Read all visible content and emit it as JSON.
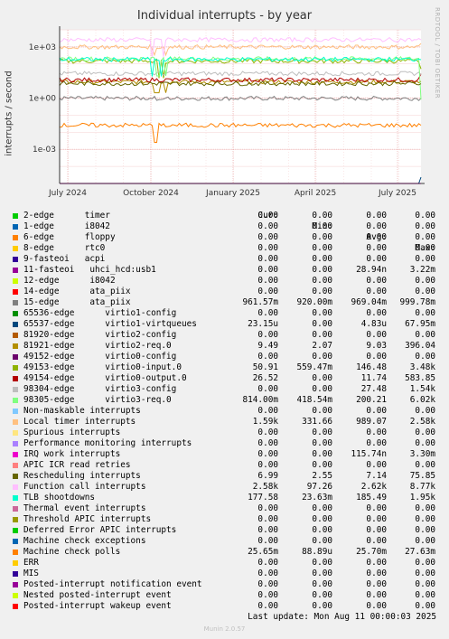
{
  "title": "Individual interrupts - by year",
  "side_label": "RRDTOOL / TOBI OETIKER",
  "footer": "Munin 2.0.57",
  "last_update": "Last update: Mon Aug 11 00:00:03 2025",
  "column_headers": {
    "cur": "Cur:",
    "min": "Min:",
    "avg": "Avg:",
    "max": "Max:"
  },
  "chart_data": {
    "type": "line",
    "title": "Individual interrupts - by year",
    "ylabel": "interrupts / second",
    "yscale": "log",
    "ylim": [
      1e-05,
      10000
    ],
    "y_ticks": [
      "1e+03",
      "1e+00",
      "1e-03"
    ],
    "x_ticks": [
      "July 2024",
      "October 2024",
      "January 2025",
      "April 2025",
      "July 2025"
    ],
    "grid": true,
    "series": [
      {
        "name": "2-edge      timer",
        "color": "#00cc00",
        "cur": "0.00",
        "min": "0.00",
        "avg": "0.00",
        "max": "0.00"
      },
      {
        "name": "1-edge      i8042",
        "color": "#0066b3",
        "cur": "0.00",
        "min": "0.00",
        "avg": "0.00",
        "max": "0.00"
      },
      {
        "name": "6-edge      floppy",
        "color": "#ff8000",
        "cur": "0.00",
        "min": "0.00",
        "avg": "0.00",
        "max": "0.00"
      },
      {
        "name": "8-edge      rtc0",
        "color": "#ffcc00",
        "cur": "0.00",
        "min": "0.00",
        "avg": "0.00",
        "max": "0.00"
      },
      {
        "name": "9-fasteoi   acpi",
        "color": "#330099",
        "cur": "0.00",
        "min": "0.00",
        "avg": "0.00",
        "max": "0.00"
      },
      {
        "name": "11-fasteoi   uhci_hcd:usb1",
        "color": "#990099",
        "cur": "0.00",
        "min": "0.00",
        "avg": "28.94n",
        "max": "3.22m"
      },
      {
        "name": "12-edge      i8042",
        "color": "#ccff00",
        "cur": "0.00",
        "min": "0.00",
        "avg": "0.00",
        "max": "0.00"
      },
      {
        "name": "14-edge      ata_piix",
        "color": "#ff0000",
        "cur": "0.00",
        "min": "0.00",
        "avg": "0.00",
        "max": "0.00"
      },
      {
        "name": "15-edge      ata_piix",
        "color": "#808080",
        "cur": "961.57m",
        "min": "920.00m",
        "avg": "969.04m",
        "max": "999.78m"
      },
      {
        "name": "65536-edge      virtio1-config",
        "color": "#008f00",
        "cur": "0.00",
        "min": "0.00",
        "avg": "0.00",
        "max": "0.00"
      },
      {
        "name": "65537-edge      virtio1-virtqueues",
        "color": "#00487d",
        "cur": "23.15u",
        "min": "0.00",
        "avg": "4.83u",
        "max": "67.95m"
      },
      {
        "name": "81920-edge      virtio2-config",
        "color": "#b35a00",
        "cur": "0.00",
        "min": "0.00",
        "avg": "0.00",
        "max": "0.00"
      },
      {
        "name": "81921-edge      virtio2-req.0",
        "color": "#b38f00",
        "cur": "9.49",
        "min": "2.07",
        "avg": "9.03",
        "max": "396.04"
      },
      {
        "name": "49152-edge      virtio0-config",
        "color": "#6b006b",
        "cur": "0.00",
        "min": "0.00",
        "avg": "0.00",
        "max": "0.00"
      },
      {
        "name": "49153-edge      virtio0-input.0",
        "color": "#8fb300",
        "cur": "50.91",
        "min": "559.47m",
        "avg": "146.48",
        "max": "3.48k"
      },
      {
        "name": "49154-edge      virtio0-output.0",
        "color": "#b30000",
        "cur": "26.52",
        "min": "0.00",
        "avg": "11.74",
        "max": "583.85"
      },
      {
        "name": "98304-edge      virtio3-config",
        "color": "#bebebe",
        "cur": "0.00",
        "min": "0.00",
        "avg": "27.48",
        "max": "1.54k"
      },
      {
        "name": "98305-edge      virtio3-req.0",
        "color": "#80ff80",
        "cur": "814.00m",
        "min": "418.54m",
        "avg": "200.21",
        "max": "6.02k"
      },
      {
        "name": "Non-maskable interrupts",
        "color": "#80c9ff",
        "cur": "0.00",
        "min": "0.00",
        "avg": "0.00",
        "max": "0.00"
      },
      {
        "name": "Local timer interrupts",
        "color": "#ffc080",
        "cur": "1.59k",
        "min": "331.66",
        "avg": "989.07",
        "max": "2.58k"
      },
      {
        "name": "Spurious interrupts",
        "color": "#ffe680",
        "cur": "0.00",
        "min": "0.00",
        "avg": "0.00",
        "max": "0.00"
      },
      {
        "name": "Performance monitoring interrupts",
        "color": "#aa80ff",
        "cur": "0.00",
        "min": "0.00",
        "avg": "0.00",
        "max": "0.00"
      },
      {
        "name": "IRQ work interrupts",
        "color": "#ee00cc",
        "cur": "0.00",
        "min": "0.00",
        "avg": "115.74n",
        "max": "3.30m"
      },
      {
        "name": "APIC ICR read retries",
        "color": "#ff8080",
        "cur": "0.00",
        "min": "0.00",
        "avg": "0.00",
        "max": "0.00"
      },
      {
        "name": "Rescheduling interrupts",
        "color": "#666600",
        "cur": "6.99",
        "min": "2.55",
        "avg": "7.14",
        "max": "75.85"
      },
      {
        "name": "Function call interrupts",
        "color": "#ffbfff",
        "cur": "2.58k",
        "min": "97.26",
        "avg": "2.62k",
        "max": "8.77k"
      },
      {
        "name": "TLB shootdowns",
        "color": "#00ffcc",
        "cur": "177.58",
        "min": "23.63m",
        "avg": "185.49",
        "max": "1.95k"
      },
      {
        "name": "Thermal event interrupts",
        "color": "#cc6699",
        "cur": "0.00",
        "min": "0.00",
        "avg": "0.00",
        "max": "0.00"
      },
      {
        "name": "Threshold APIC interrupts",
        "color": "#999900",
        "cur": "0.00",
        "min": "0.00",
        "avg": "0.00",
        "max": "0.00"
      },
      {
        "name": "Deferred Error APIC interrupts",
        "color": "#00cc00",
        "cur": "0.00",
        "min": "0.00",
        "avg": "0.00",
        "max": "0.00"
      },
      {
        "name": "Machine check exceptions",
        "color": "#0066b3",
        "cur": "0.00",
        "min": "0.00",
        "avg": "0.00",
        "max": "0.00"
      },
      {
        "name": "Machine check polls",
        "color": "#ff8000",
        "cur": "25.65m",
        "min": "88.89u",
        "avg": "25.70m",
        "max": "27.63m"
      },
      {
        "name": "ERR",
        "color": "#ffcc00",
        "cur": "0.00",
        "min": "0.00",
        "avg": "0.00",
        "max": "0.00"
      },
      {
        "name": "MIS",
        "color": "#330099",
        "cur": "0.00",
        "min": "0.00",
        "avg": "0.00",
        "max": "0.00"
      },
      {
        "name": "Posted-interrupt notification event",
        "color": "#990099",
        "cur": "0.00",
        "min": "0.00",
        "avg": "0.00",
        "max": "0.00"
      },
      {
        "name": "Nested posted-interrupt event",
        "color": "#ccff00",
        "cur": "0.00",
        "min": "0.00",
        "avg": "0.00",
        "max": "0.00"
      },
      {
        "name": "Posted-interrupt wakeup event",
        "color": "#ff0000",
        "cur": "0.00",
        "min": "0.00",
        "avg": "0.00",
        "max": "0.00"
      }
    ]
  }
}
